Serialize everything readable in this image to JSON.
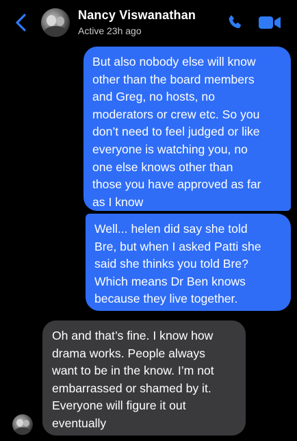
{
  "header": {
    "contact_name": "Nancy Viswanathan",
    "status": "Active 23h ago",
    "back_icon": "chevron-left-icon",
    "call_icon": "phone-icon",
    "video_icon": "video-camera-icon",
    "accent_color": "#2f6df6"
  },
  "messages": [
    {
      "direction": "outgoing",
      "lines": [
        "But also nobody else will know",
        "other than the board members",
        "and Greg, no hosts, no",
        "moderators or crew etc. So you",
        "don’t need to feel judged or like",
        "everyone is watching you, no",
        "one else knows other than",
        "those you have approved as far",
        "as I know"
      ]
    },
    {
      "direction": "outgoing",
      "lines": [
        "Well... helen did say she told",
        "Bre, but when I asked Patti she",
        "said she thinks you told Bre?",
        "Which means Dr Ben knows",
        "because they live together."
      ]
    },
    {
      "direction": "incoming",
      "lines": [
        "Oh and that’s fine. I know how",
        "drama works. People always",
        "want to be in the know. I’m not",
        "embarrassed or shamed by it.",
        "Everyone will figure it out",
        "eventually"
      ]
    }
  ],
  "colors": {
    "outgoing_bubble": "#2f6df6",
    "incoming_bubble": "#3a3a3c",
    "background": "#000000"
  }
}
